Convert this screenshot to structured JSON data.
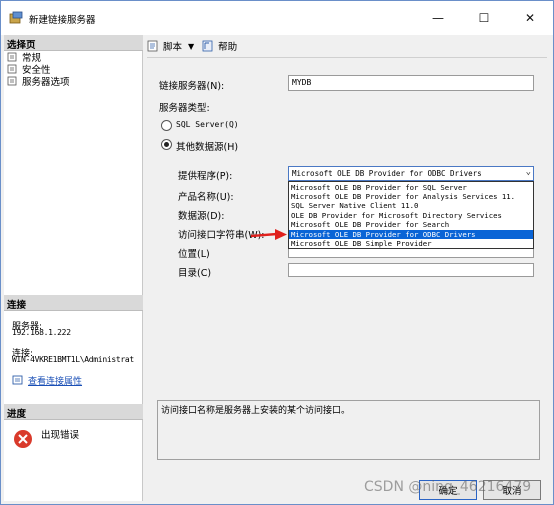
{
  "window": {
    "title": "新建链接服务器",
    "minimize_glyph": "—",
    "maximize_glyph": "☐",
    "close_glyph": "✕"
  },
  "left_pane": {
    "select_page_header": "选择页",
    "pages": [
      {
        "label": "常规",
        "icon": "page-icon"
      },
      {
        "label": "安全性",
        "icon": "page-icon"
      },
      {
        "label": "服务器选项",
        "icon": "page-icon"
      }
    ],
    "connection_header": "连接",
    "server_label": "服务器:",
    "server_value": "192.168.1.222",
    "connection_label": "连接:",
    "connection_value": "WIN-4VKRE1BMT1L\\Administrat",
    "view_connection_properties": "查看连接属性",
    "progress_header": "进度",
    "progress_status": "出现错误"
  },
  "toolbar": {
    "script_label": "脚本",
    "help_label": "帮助"
  },
  "form": {
    "linked_server_label": "链接服务器(N):",
    "linked_server_value": "MYDB",
    "server_type_label": "服务器类型:",
    "sql_server_option": "SQL Server(Q)",
    "other_source_option": "其他数据源(H)",
    "provider_label": "提供程序(P):",
    "provider_value": "Microsoft OLE DB Provider for ODBC Drivers",
    "product_name_label": "产品名称(U):",
    "data_source_label": "数据源(D):",
    "provider_string_label": "访问接口字符串(W):",
    "location_label": "位置(L)",
    "catalog_label": "目录(C)",
    "provider_options": [
      "Microsoft OLE DB Provider for SQL Server",
      "Microsoft OLE DB Provider for Analysis Services 11.",
      "SQL Server Native Client 11.0",
      "OLE DB Provider for Microsoft Directory Services",
      "Microsoft OLE DB Provider for Search",
      "Microsoft OLE DB Provider for ODBC Drivers",
      "Microsoft OLE DB Simple Provider"
    ],
    "selected_option_index": 5,
    "description": "访问接口名称是服务器上安装的某个访问接口。"
  },
  "buttons": {
    "ok": "确定",
    "cancel": "取消"
  },
  "watermark": "CSDN @ning_46216479",
  "colors": {
    "selection": "#0a64d6",
    "arrow": "#e0201c"
  }
}
